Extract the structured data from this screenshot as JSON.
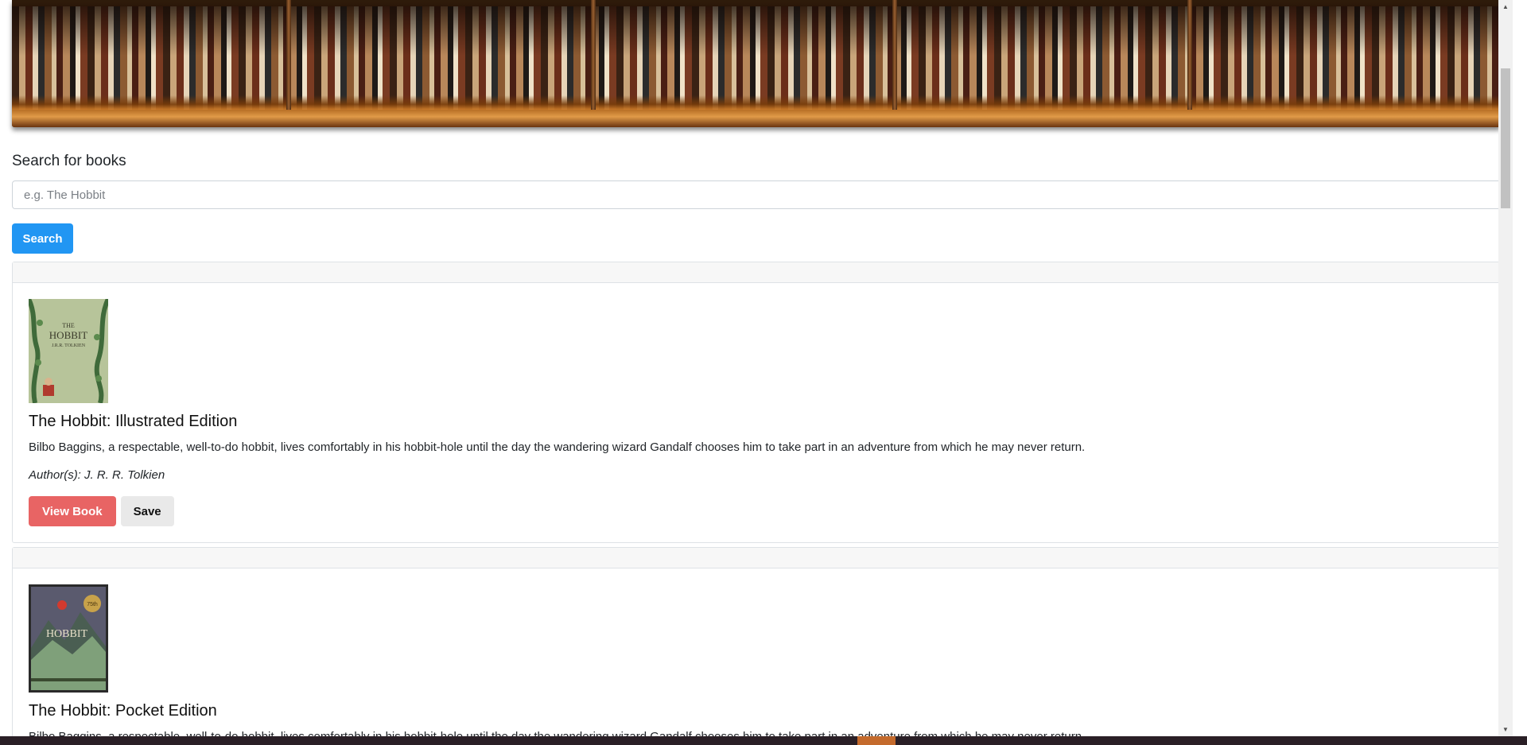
{
  "search": {
    "label": "Search for books",
    "placeholder": "e.g. The Hobbit",
    "button_label": "Search"
  },
  "results": [
    {
      "title": "The Hobbit: Illustrated Edition",
      "description": "Bilbo Baggins, a respectable, well-to-do hobbit, lives comfortably in his hobbit-hole until the day the wandering wizard Gandalf chooses him to take part in an adventure from which he may never return.",
      "authors": "Author(s): J. R. R. Tolkien",
      "cover_text": [
        "THE",
        "HOBBIT",
        "J.R.R. TOLKIEN"
      ],
      "view_label": "View Book",
      "save_label": "Save"
    },
    {
      "title": "The Hobbit: Pocket Edition",
      "description": "Bilbo Baggins, a respectable, well-to-do hobbit, lives comfortably in his hobbit-hole until the day the wandering wizard Gandalf chooses him to take part in an adventure from which he may never return.",
      "cover_text": [
        "HOBBIT",
        "75th"
      ]
    }
  ],
  "colors": {
    "primary": "#2196f3",
    "view_button": "#e86464",
    "save_button": "#e9e9e9"
  },
  "icons": {
    "scroll_up": "scroll-up-arrow-icon",
    "scroll_down": "scroll-down-arrow-icon"
  }
}
